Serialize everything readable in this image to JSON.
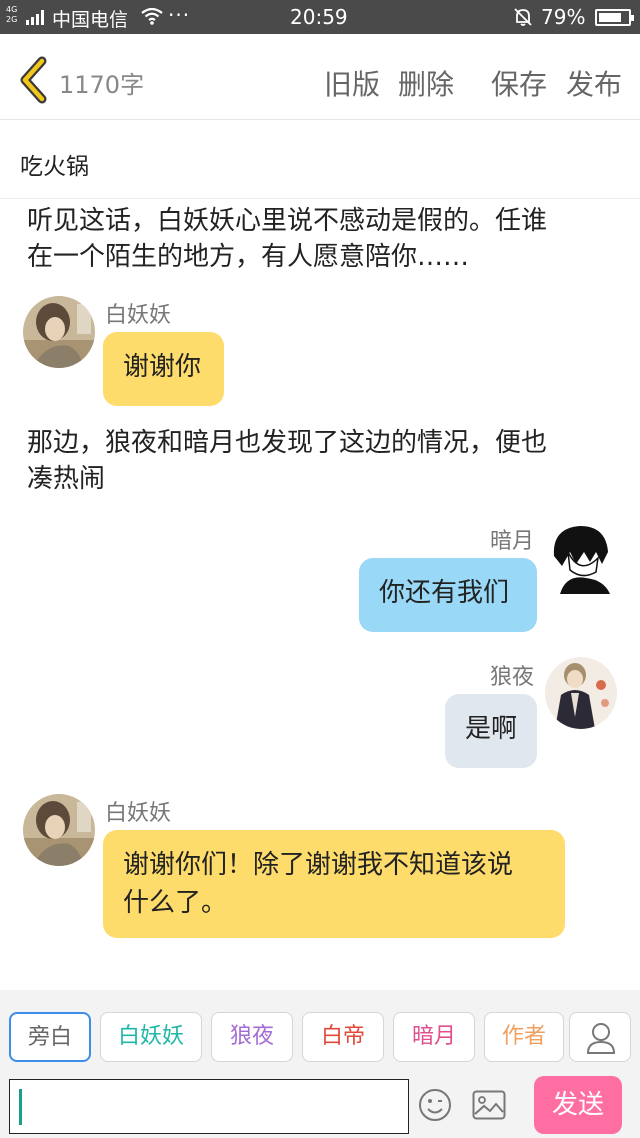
{
  "status_bar": {
    "network_top": "4G",
    "network_bottom": "2G",
    "carrier": "中国电信",
    "more": "···",
    "time": "20:59",
    "battery": "79%",
    "battery_level": 0.79
  },
  "header": {
    "word_count": "1170字",
    "old_version": "旧版",
    "delete": "删除",
    "save": "保存",
    "publish": "发布"
  },
  "story_title": "吃火锅",
  "messages": [
    {
      "type": "narration",
      "text_lines": [
        "听见这话，白妖妖心里说不感动是假的。任谁",
        "在一个陌生的地方，有人愿意陪你……"
      ]
    },
    {
      "type": "left",
      "speaker": "白妖妖",
      "text": "谢谢你"
    },
    {
      "type": "narration",
      "text_lines": [
        "那边，狼夜和暗月也发现了这边的情况，便也",
        "凑热闹"
      ]
    },
    {
      "type": "right",
      "speaker": "暗月",
      "text": "你还有我们"
    },
    {
      "type": "right",
      "speaker": "狼夜",
      "text": "是啊"
    },
    {
      "type": "left",
      "speaker": "白妖妖",
      "text_lines": [
        "谢谢你们！除了谢谢我不知道该说",
        "什么了。"
      ]
    }
  ],
  "characters": [
    {
      "label": "旁白",
      "color": "#666666"
    },
    {
      "label": "白妖妖",
      "color": "#1fb7a7"
    },
    {
      "label": "狼夜",
      "color": "#a36bd6"
    },
    {
      "label": "白帝",
      "color": "#e0483a"
    },
    {
      "label": "暗月",
      "color": "#e04f8c"
    },
    {
      "label": "作者",
      "color": "#f0a060"
    }
  ],
  "input": {
    "value": "",
    "send": "发送"
  },
  "icons": [
    "back-chevron-icon",
    "wifi-icon",
    "bell-muted-icon",
    "battery-icon",
    "user-icon",
    "emoji-icon",
    "image-icon"
  ]
}
